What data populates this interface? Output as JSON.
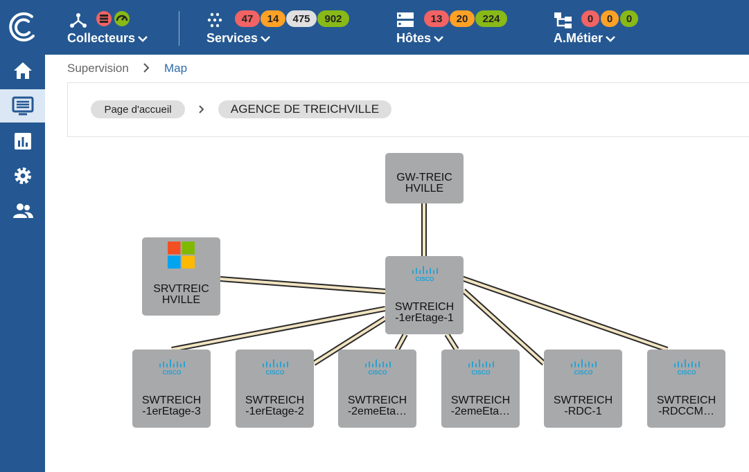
{
  "topbar": {
    "collectors": {
      "label": "Collecteurs"
    },
    "services": {
      "label": "Services",
      "counts": [
        "47",
        "14",
        "475",
        "902"
      ]
    },
    "hosts": {
      "label": "Hôtes",
      "counts": [
        "13",
        "20",
        "224"
      ]
    },
    "business": {
      "label": "A.Métier",
      "counts": [
        "0",
        "0",
        "0"
      ]
    }
  },
  "colors": {
    "navy": "#255892",
    "critical": "#f16364",
    "warning": "#ffa125",
    "unknown": "#e0e0e0",
    "ok": "#88b917",
    "node": "#a8a9ab",
    "link": "#f2e4c1",
    "cisco": "#1aa1d6"
  },
  "sidebar": {
    "items": [
      {
        "icon": "home-icon"
      },
      {
        "icon": "monitor-icon",
        "active": true
      },
      {
        "icon": "chart-icon"
      },
      {
        "icon": "gear-icon"
      },
      {
        "icon": "users-icon"
      }
    ]
  },
  "breadcrumb": {
    "root": "Supervision",
    "current": "Map"
  },
  "map_path": {
    "home": "Page d'accueil",
    "current": "AGENCE DE TREICHVILLE"
  },
  "nodes": [
    {
      "name": "GW-TREIC\nHVILLE",
      "icon": "none"
    },
    {
      "name": "SRVTREIC\nHVILLE",
      "icon": "windows-logo"
    },
    {
      "name": "SWTREICH\n-1erEtage-1",
      "icon": "cisco-logo"
    },
    {
      "name": "SWTREICH\n-1erEtage-3",
      "icon": "cisco-logo"
    },
    {
      "name": "SWTREICH\n-1erEtage-2",
      "icon": "cisco-logo"
    },
    {
      "name": "SWTREICH\n-2emeEta…",
      "icon": "cisco-logo"
    },
    {
      "name": "SWTREICH\n-2emeEta…",
      "icon": "cisco-logo"
    },
    {
      "name": "SWTREICH\n-RDC-1",
      "icon": "cisco-logo"
    },
    {
      "name": "SWTREICH\n-RDCCM…",
      "icon": "cisco-logo"
    }
  ]
}
